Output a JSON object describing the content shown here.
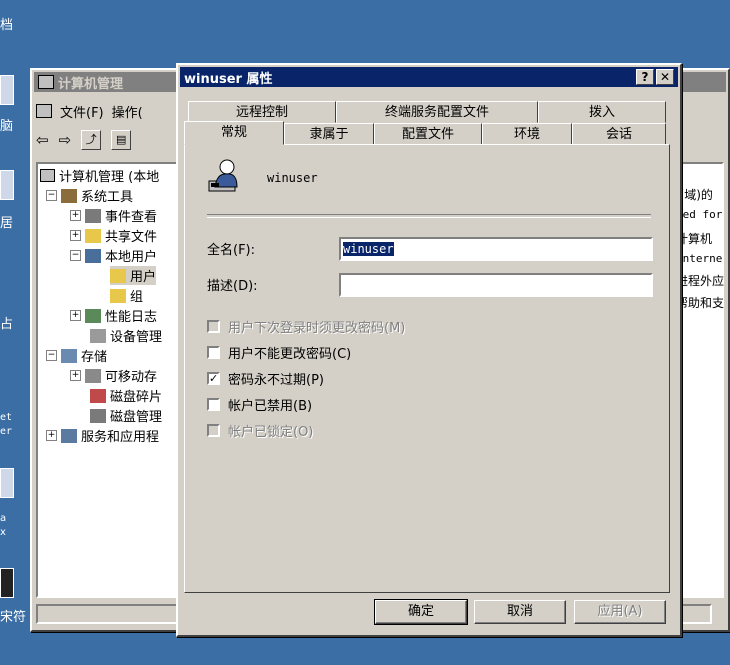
{
  "desktop": {
    "labels": [
      "档",
      "脑",
      "居",
      "占",
      "et",
      "er",
      "a",
      "x",
      "宋符"
    ]
  },
  "mmc": {
    "title": "计算机管理",
    "menu": [
      "文件(F)",
      "操作("
    ],
    "tree": [
      {
        "label": "计算机管理 (本地",
        "expander": ""
      },
      {
        "label": "系统工具",
        "expander": "−"
      },
      {
        "label": "事件查看",
        "expander": "+"
      },
      {
        "label": "共享文件",
        "expander": "+"
      },
      {
        "label": "本地用户",
        "expander": "−"
      },
      {
        "label": "用户",
        "expander": ""
      },
      {
        "label": "组",
        "expander": ""
      },
      {
        "label": "性能日志",
        "expander": "+"
      },
      {
        "label": "设备管理",
        "expander": ""
      },
      {
        "label": "存储",
        "expander": "−"
      },
      {
        "label": "可移动存",
        "expander": "+"
      },
      {
        "label": "磁盘碎片",
        "expander": ""
      },
      {
        "label": "磁盘管理",
        "expander": ""
      },
      {
        "label": "服务和应用程",
        "expander": "+"
      }
    ],
    "right_snippets": [
      "Ⅰ(域)的",
      "sed for",
      "计算机",
      "Interne",
      "进程外应",
      "帮助和支"
    ]
  },
  "dialog": {
    "title": "winuser 属性",
    "help_btn": "?",
    "close_btn": "✕",
    "tabs_top": [
      "远程控制",
      "终端服务配置文件",
      "拨入"
    ],
    "tabs_bottom": [
      "常规",
      "隶属于",
      "配置文件",
      "环境",
      "会话"
    ],
    "username": "winuser",
    "fullname_label": "全名(F):",
    "fullname_value": "winuser",
    "desc_label": "描述(D):",
    "desc_value": "",
    "checkboxes": [
      {
        "label": "用户下次登录时须更改密码(M)",
        "checked": false,
        "disabled": true
      },
      {
        "label": "用户不能更改密码(C)",
        "checked": false,
        "disabled": false
      },
      {
        "label": "密码永不过期(P)",
        "checked": true,
        "disabled": false
      },
      {
        "label": "帐户已禁用(B)",
        "checked": false,
        "disabled": false
      },
      {
        "label": "帐户已锁定(O)",
        "checked": false,
        "disabled": true
      }
    ],
    "buttons": {
      "ok": "确定",
      "cancel": "取消",
      "apply": "应用(A)"
    }
  }
}
